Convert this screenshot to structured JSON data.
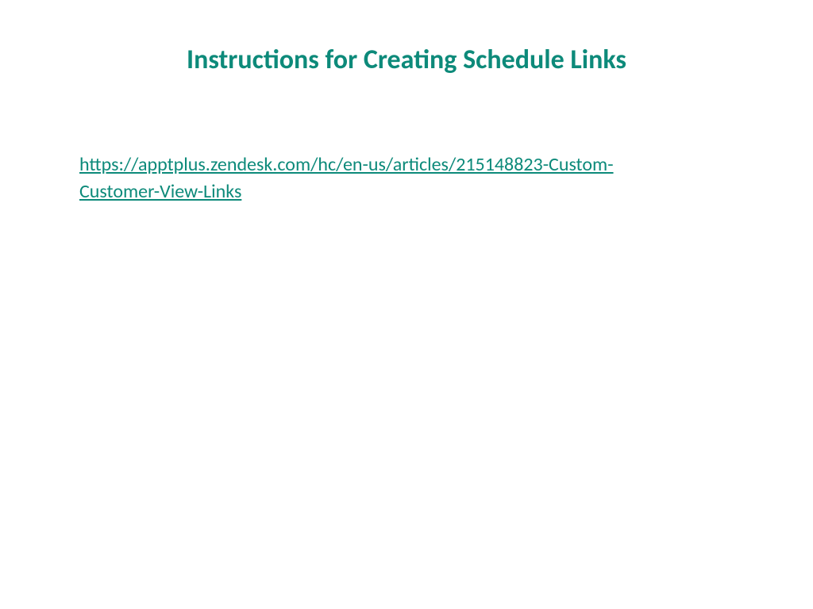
{
  "slide": {
    "title": "Instructions for Creating Schedule Links",
    "link_text": "https://apptplus.zendesk.com/hc/en-us/articles/215148823-Custom-Customer-View-Links",
    "link_href": "https://apptplus.zendesk.com/hc/en-us/articles/215148823-Custom-Customer-View-Links"
  },
  "colors": {
    "accent": "#0d8a7a",
    "background": "#ffffff"
  }
}
